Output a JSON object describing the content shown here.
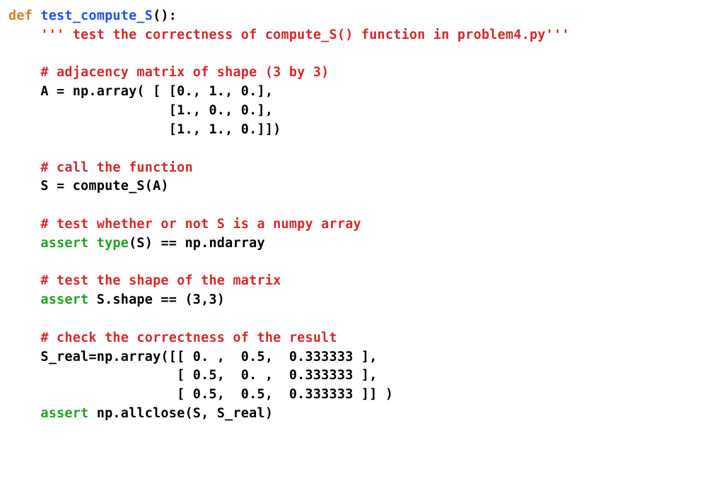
{
  "code": {
    "kw_def": "def",
    "fn_name": "test_compute_S",
    "sig_tail": "():",
    "docstring": "''' test the correctness of compute_S() function in problem4.py'''",
    "comment_adj": "# adjacency matrix of shape (3 by 3)",
    "arr_l1": "A = np.array( [ [0., 1., 0.],",
    "arr_l2": "                [1., 0., 0.],",
    "arr_l3": "                [1., 1., 0.]])",
    "comment_call": "# call the function",
    "call_line": "S = compute_S(A)",
    "comment_type": "# test whether or not S is a numpy array",
    "kw_assert": "assert",
    "kw_type": "type",
    "assert_type_tail": "(S) == np.ndarray",
    "comment_shape": "# test the shape of the matrix",
    "assert_shape_tail": " S.shape == (3,3)",
    "comment_correct": "# check the correctness of the result",
    "sreal_l1": "S_real=np.array([[ 0. ,  0.5,  0.333333 ],",
    "sreal_l2": "                 [ 0.5,  0. ,  0.333333 ],",
    "sreal_l3": "                 [ 0.5,  0.5,  0.333333 ]] )",
    "assert_close_tail": " np.allclose(S, S_real)"
  }
}
